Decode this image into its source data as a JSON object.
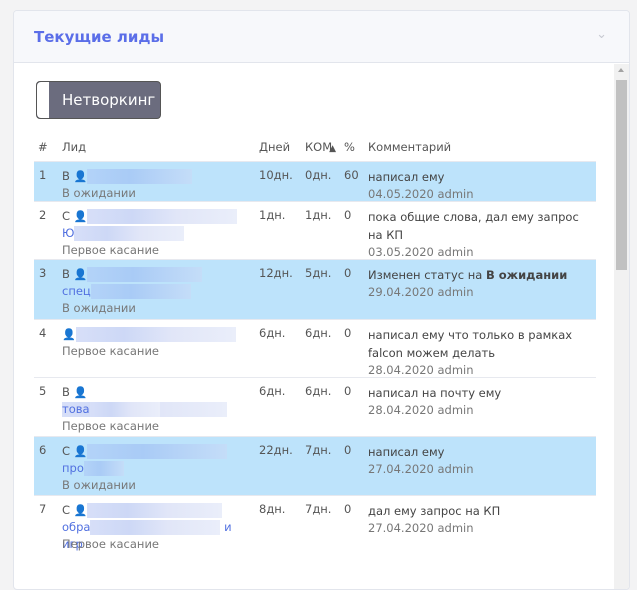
{
  "panel": {
    "title": "Текущие лиды",
    "toggle_label": "Нетворкинг"
  },
  "table": {
    "headers": [
      "#",
      "Лид",
      "Дней",
      "КОМ",
      "%",
      "Комментарий"
    ],
    "rows": [
      {
        "num": "1",
        "prefix": "В",
        "link": "",
        "status": "В ожидании",
        "days": "10дн.",
        "kom": "0дн.",
        "pct": "60",
        "comment": "написал ему",
        "comment_bold": "",
        "date": "04.05.2020 admin",
        "hl": true
      },
      {
        "num": "2",
        "prefix": "С",
        "link": "Ю",
        "status": "Первое касание",
        "days": "1дн.",
        "kom": "1дн.",
        "pct": "0",
        "comment": "пока общие слова, дал ему запрос на КП",
        "comment_bold": "",
        "date": "03.05.2020 admin",
        "hl": false
      },
      {
        "num": "3",
        "prefix": "В",
        "link": "спец",
        "status": "В ожидании",
        "days": "12дн.",
        "kom": "5дн.",
        "pct": "0",
        "comment": "Изменен статус на ",
        "comment_bold": "В ожидании",
        "date": "29.04.2020 admin",
        "hl": true
      },
      {
        "num": "4",
        "prefix": "",
        "link": "",
        "status": "Первое касание",
        "days": "6дн.",
        "kom": "6дн.",
        "pct": "0",
        "comment": "написал ему что только в рамках falcon можем делать",
        "comment_bold": "",
        "date": "28.04.2020 admin",
        "hl": false
      },
      {
        "num": "5",
        "prefix": "В",
        "link": "това",
        "status": "Первое касание",
        "days": "6дн.",
        "kom": "6дн.",
        "pct": "0",
        "comment": "написал на почту ему",
        "comment_bold": "",
        "date": "28.04.2020 admin",
        "hl": false
      },
      {
        "num": "6",
        "prefix": "С",
        "link": "про",
        "status": "В ожидании",
        "days": "22дн.",
        "kom": "7дн.",
        "pct": "0",
        "comment": "написал ему",
        "comment_bold": "",
        "date": "27.04.2020 admin",
        "hl": true
      },
      {
        "num": "7",
        "prefix": "С",
        "link": "обра",
        "link2": "и игр",
        "status": "Первое касание",
        "days": "8дн.",
        "kom": "7дн.",
        "pct": "0",
        "comment": "дал ему запрос на КП",
        "comment_bold": "",
        "date": "27.04.2020 admin",
        "hl": false
      }
    ]
  }
}
